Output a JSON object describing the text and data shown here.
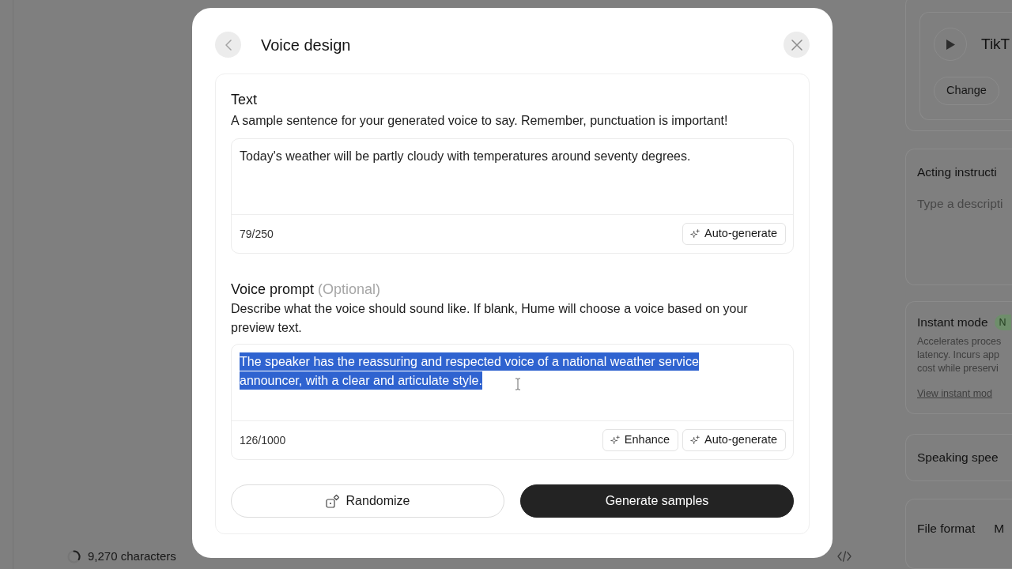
{
  "side_panel": {
    "voice": {
      "name": "TikT",
      "change_button": "Change"
    },
    "acting_instructions": {
      "label": "Acting instructi",
      "placeholder": "Type a descripti"
    },
    "instant_mode": {
      "label": "Instant mode",
      "badge": "N",
      "description_lines": [
        "Accelerates proces",
        "latency. Incurs app",
        "cost while preservi"
      ],
      "link": "View instant mod"
    },
    "speaking_speed": {
      "label": "Speaking spee"
    },
    "file_format": {
      "label": "File format",
      "value": "M"
    }
  },
  "status_bar": {
    "usage": "9,270 characters"
  },
  "dialog": {
    "title": "Voice design",
    "text_section": {
      "heading": "Text",
      "description": "A sample sentence for your generated voice to say. Remember, punctuation is important!",
      "value": "Today's weather will be partly cloudy with temperatures around seventy degrees.",
      "count": "79/250",
      "buttons": [
        "Auto-generate"
      ]
    },
    "voice_prompt": {
      "heading": "Voice prompt",
      "optional_note": "(Optional)",
      "description": "Describe what the voice should sound like. If blank, Hume will choose a voice based on your preview text.",
      "value": "The speaker has the reassuring and respected voice of a national weather service announcer, with a clear and articulate style.",
      "selected": true,
      "count": "126/1000",
      "buttons": [
        "Enhance",
        "Auto-generate"
      ]
    },
    "actions": [
      {
        "kind": "secondary",
        "label": "Randomize"
      },
      {
        "kind": "primary",
        "label": "Generate samples"
      }
    ]
  }
}
